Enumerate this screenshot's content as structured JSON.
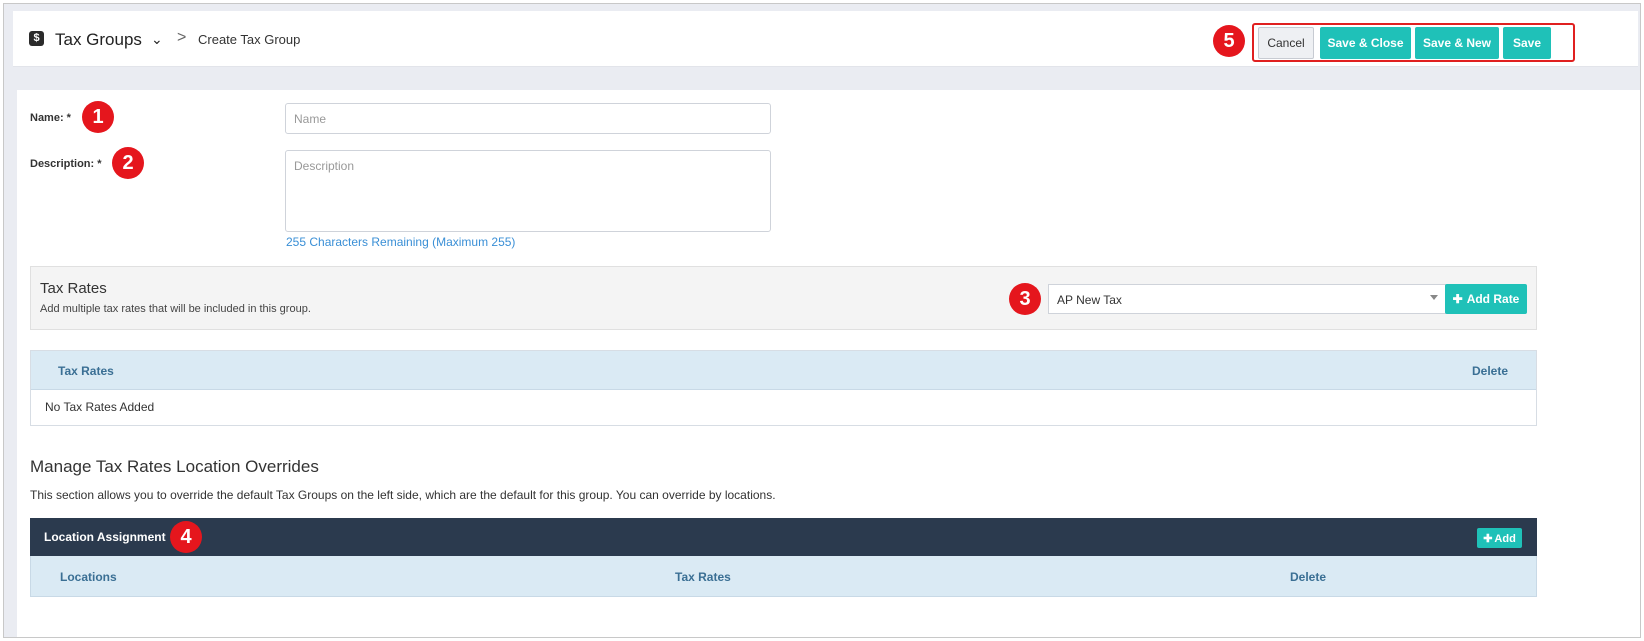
{
  "header": {
    "app_icon": "$",
    "app_title": "Tax Groups",
    "breadcrumb_sep": ">",
    "breadcrumb_current": "Create Tax Group",
    "buttons": {
      "cancel": "Cancel",
      "save_close": "Save & Close",
      "save_new": "Save & New",
      "save": "Save"
    }
  },
  "form": {
    "name_label": "Name: *",
    "name_placeholder": "Name",
    "description_label": "Description: *",
    "description_placeholder": "Description",
    "remaining": "255 Characters Remaining (Maximum 255)"
  },
  "tax_rates": {
    "title": "Tax Rates",
    "subtitle": "Add multiple tax rates that will be included in this group.",
    "selected": "AP New Tax",
    "add_button": "Add Rate",
    "columns": [
      "Tax Rates",
      "Delete"
    ],
    "empty": "No Tax Rates Added"
  },
  "overrides": {
    "title": "Manage Tax Rates Location Overrides",
    "description": "This section allows you to override the default Tax Groups on the left side, which are the default for this group. You can override by locations.",
    "location_header": "Location Assignment",
    "add_button": "Add",
    "columns": [
      "Locations",
      "Tax Rates",
      "Delete"
    ]
  },
  "badges": [
    "1",
    "2",
    "3",
    "4",
    "5"
  ],
  "colors": {
    "accent": "#1fc1b8",
    "badge": "#e5161d",
    "dark_header": "#2b3a4e",
    "table_header": "#daeaf4"
  }
}
